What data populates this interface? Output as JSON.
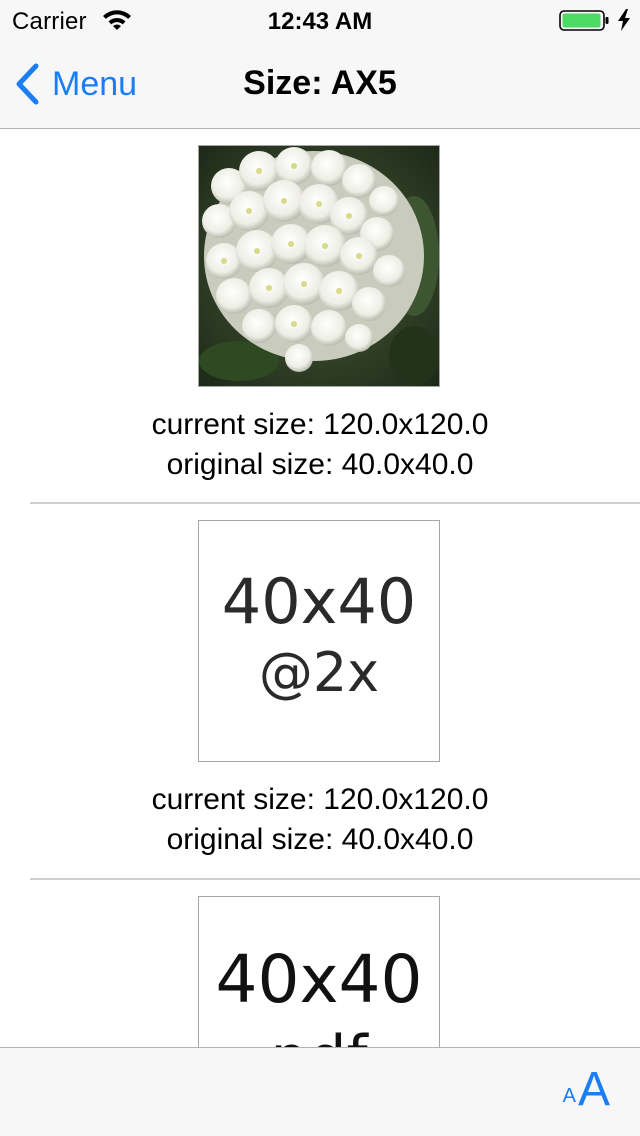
{
  "status_bar": {
    "carrier": "Carrier",
    "time": "12:43 AM",
    "battery_color": "#4cd964",
    "wifi_icon": "wifi-icon",
    "charging_icon": "bolt-icon"
  },
  "nav": {
    "back_label": "Menu",
    "back_icon": "chevron-left-icon",
    "title": "Size: AX5",
    "tint_color": "#1a7ef5"
  },
  "cells": [
    {
      "image_kind": "photo-white-flowers",
      "current_size": "current size: 120.0x120.0",
      "original_size": "original size: 40.0x40.0"
    },
    {
      "image_kind": "placeholder",
      "placeholder_line1": "40x40",
      "placeholder_line2": "@2x",
      "current_size": "current size: 120.0x120.0",
      "original_size": "original size: 40.0x40.0"
    },
    {
      "image_kind": "placeholder",
      "placeholder_line1": "40x40",
      "placeholder_line2": "pdf"
    }
  ],
  "toolbar": {
    "text_size_small": "A",
    "text_size_large": "A"
  }
}
